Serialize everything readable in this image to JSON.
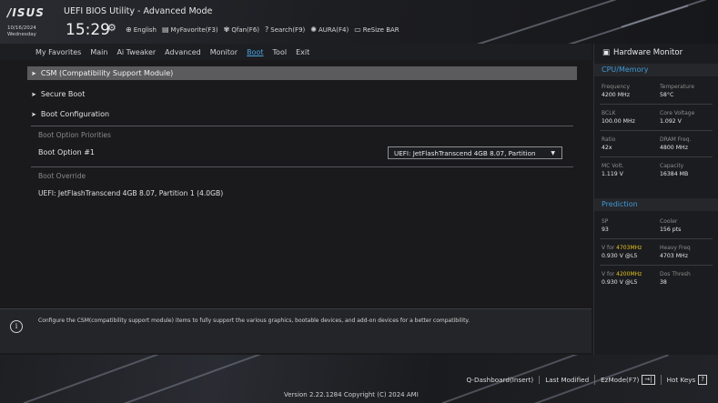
{
  "header": {
    "logo": "/ISUS",
    "title": "UEFI BIOS Utility - Advanced Mode",
    "date": "10/16/2024",
    "weekday": "Wednesday",
    "time": "15:29",
    "toolbar": [
      {
        "icon": "globe-icon",
        "glyph": "⊕",
        "label": "English"
      },
      {
        "icon": "favorite-icon",
        "glyph": "▤",
        "label": "MyFavorite(F3)"
      },
      {
        "icon": "fan-icon",
        "glyph": "✾",
        "label": "Qfan(F6)"
      },
      {
        "icon": "search-icon",
        "glyph": "?",
        "label": "Search(F9)"
      },
      {
        "icon": "aura-icon",
        "glyph": "✺",
        "label": "AURA(F4)"
      },
      {
        "icon": "resize-bar-icon",
        "glyph": "▭",
        "label": "ReSize BAR"
      }
    ]
  },
  "menu": {
    "items": [
      "My Favorites",
      "Main",
      "Ai Tweaker",
      "Advanced",
      "Monitor",
      "Boot",
      "Tool",
      "Exit"
    ],
    "active_index": 5,
    "active_color": "#4aa3e0"
  },
  "main": {
    "submenus": [
      "CSM (Compatibility Support Module)",
      "Secure Boot",
      "Boot Configuration"
    ],
    "boot_priorities_header": "Boot Option Priorities",
    "boot_option_label": "Boot Option #1",
    "boot_option_value": "UEFI: JetFlashTranscend 4GB 8.07, Partition",
    "boot_override_header": "Boot Override",
    "override_items": [
      "UEFI: JetFlashTranscend 4GB 8.07, Partition 1 (4.0GB)"
    ]
  },
  "help": {
    "text": "Configure the CSM(compatibility support module) items to fully support the various graphics, bootable devices, and add-on devices for a better compatibility."
  },
  "hwmon": {
    "title": "Hardware Monitor",
    "cpu_memory_header": "CPU/Memory",
    "cpu_rows": [
      {
        "l1": "Frequency",
        "v1": "4200 MHz",
        "l2": "Temperature",
        "v2": "58°C"
      },
      {
        "l1": "BCLK",
        "v1": "100.00 MHz",
        "l2": "Core Voltage",
        "v2": "1.092 V"
      },
      {
        "l1": "Ratio",
        "v1": "42x",
        "l2": "DRAM Freq.",
        "v2": "4800 MHz"
      },
      {
        "l1": "MC Volt.",
        "v1": "1.119 V",
        "l2": "Capacity",
        "v2": "16384 MB"
      }
    ],
    "prediction_header": "Prediction",
    "prediction_rows": [
      {
        "l1": "SP",
        "v1": "93",
        "l2": "Cooler",
        "v2": "156 pts"
      },
      {
        "l1_pre": "V for ",
        "l1_hi": "4703MHz",
        "v1": "0.930 V @L5",
        "l2": "Heavy Freq",
        "v2": "4703 MHz"
      },
      {
        "l1_pre": "V for ",
        "l1_hi": "4200MHz",
        "v1": "0.930 V @L5",
        "l2": "Dos Thresh",
        "v2": "38"
      }
    ],
    "accent_color": "#3d9ad6",
    "highlight_color": "#e3c21e"
  },
  "footer": {
    "links": [
      "Q-Dashboard(Insert)",
      "Last Modified",
      "EzMode(F7)",
      "Hot Keys"
    ],
    "ezmode_icon_glyph": "→|",
    "hotkeys_icon_glyph": "?",
    "version": "Version 2.22.1284 Copyright (C) 2024 AMI"
  }
}
